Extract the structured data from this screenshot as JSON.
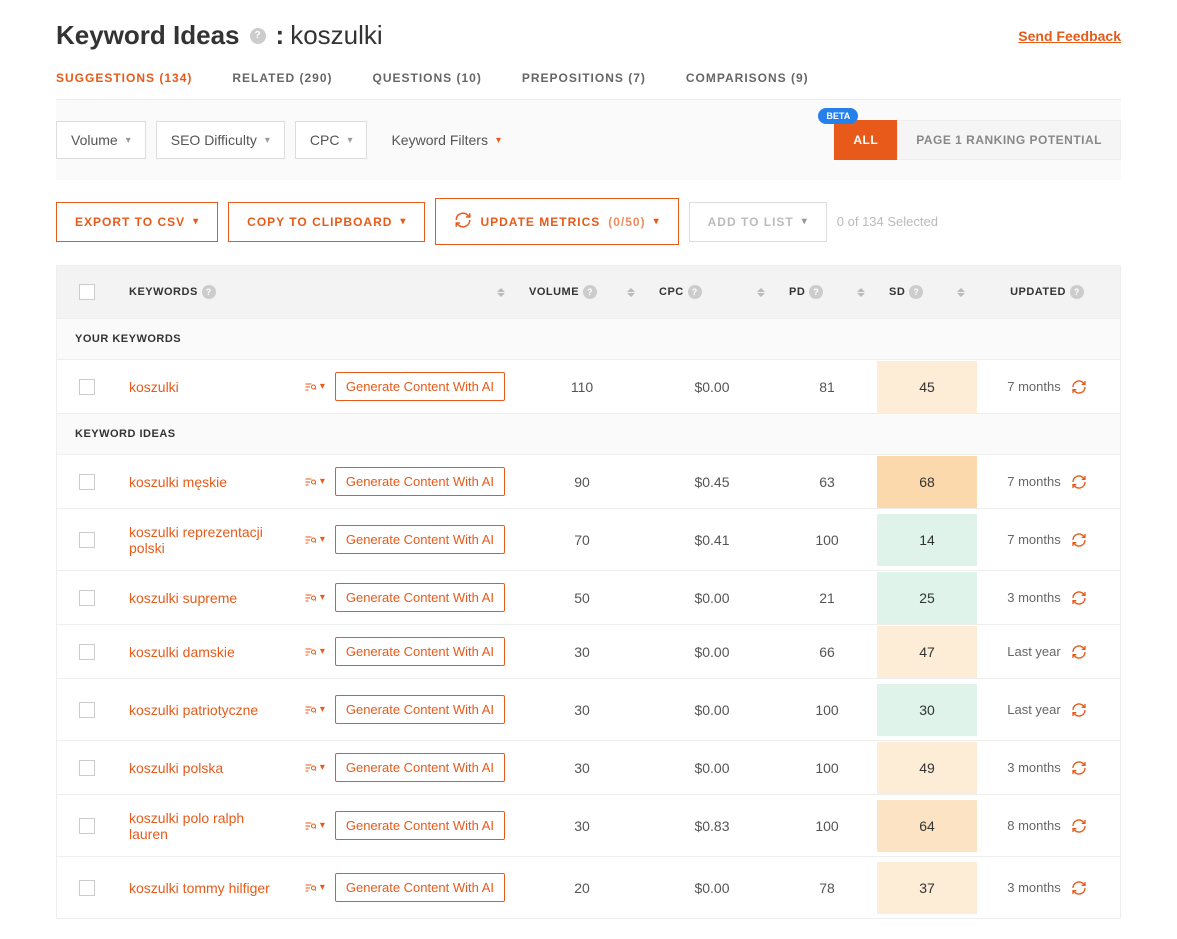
{
  "header": {
    "title": "Keyword Ideas",
    "keyword": "koszulki",
    "feedback": "Send Feedback"
  },
  "tabs": [
    {
      "label": "SUGGESTIONS (134)",
      "active": true
    },
    {
      "label": "RELATED (290)",
      "active": false
    },
    {
      "label": "QUESTIONS (10)",
      "active": false
    },
    {
      "label": "PREPOSITIONS (7)",
      "active": false
    },
    {
      "label": "COMPARISONS (9)",
      "active": false
    }
  ],
  "filters": {
    "volume": "Volume",
    "seo": "SEO Difficulty",
    "cpc": "CPC",
    "keyword_filters": "Keyword Filters",
    "beta": "BETA",
    "toggle_all": "ALL",
    "toggle_potential": "PAGE 1 RANKING POTENTIAL"
  },
  "actions": {
    "export": "EXPORT TO CSV",
    "copy": "COPY TO CLIPBOARD",
    "update": "UPDATE METRICS",
    "update_count": "(0/50)",
    "add": "ADD TO LIST",
    "selected": "0 of 134 Selected"
  },
  "columns": {
    "keywords": "KEYWORDS",
    "volume": "VOLUME",
    "cpc": "CPC",
    "pd": "PD",
    "sd": "SD",
    "updated": "UPDATED"
  },
  "sections": {
    "your": "YOUR KEYWORDS",
    "ideas": "KEYWORD IDEAS"
  },
  "gen_label": "Generate Content With AI",
  "your_keywords": [
    {
      "keyword": "koszulki",
      "volume": "110",
      "cpc": "$0.00",
      "pd": "81",
      "sd": "45",
      "sd_class": "sd-orange1",
      "updated": "7 months"
    }
  ],
  "ideas": [
    {
      "keyword": "koszulki męskie",
      "volume": "90",
      "cpc": "$0.45",
      "pd": "63",
      "sd": "68",
      "sd_class": "sd-orange3",
      "updated": "7 months"
    },
    {
      "keyword": "koszulki reprezentacji polski",
      "volume": "70",
      "cpc": "$0.41",
      "pd": "100",
      "sd": "14",
      "sd_class": "sd-green",
      "updated": "7 months"
    },
    {
      "keyword": "koszulki supreme",
      "volume": "50",
      "cpc": "$0.00",
      "pd": "21",
      "sd": "25",
      "sd_class": "sd-green",
      "updated": "3 months"
    },
    {
      "keyword": "koszulki damskie",
      "volume": "30",
      "cpc": "$0.00",
      "pd": "66",
      "sd": "47",
      "sd_class": "sd-orange1",
      "updated": "Last year"
    },
    {
      "keyword": "koszulki patriotyczne",
      "volume": "30",
      "cpc": "$0.00",
      "pd": "100",
      "sd": "30",
      "sd_class": "sd-green",
      "updated": "Last year"
    },
    {
      "keyword": "koszulki polska",
      "volume": "30",
      "cpc": "$0.00",
      "pd": "100",
      "sd": "49",
      "sd_class": "sd-orange1",
      "updated": "3 months"
    },
    {
      "keyword": "koszulki polo ralph lauren",
      "volume": "30",
      "cpc": "$0.83",
      "pd": "100",
      "sd": "64",
      "sd_class": "sd-orange2",
      "updated": "8 months"
    },
    {
      "keyword": "koszulki tommy hilfiger",
      "volume": "20",
      "cpc": "$0.00",
      "pd": "78",
      "sd": "37",
      "sd_class": "sd-orange1",
      "updated": "3 months"
    }
  ]
}
